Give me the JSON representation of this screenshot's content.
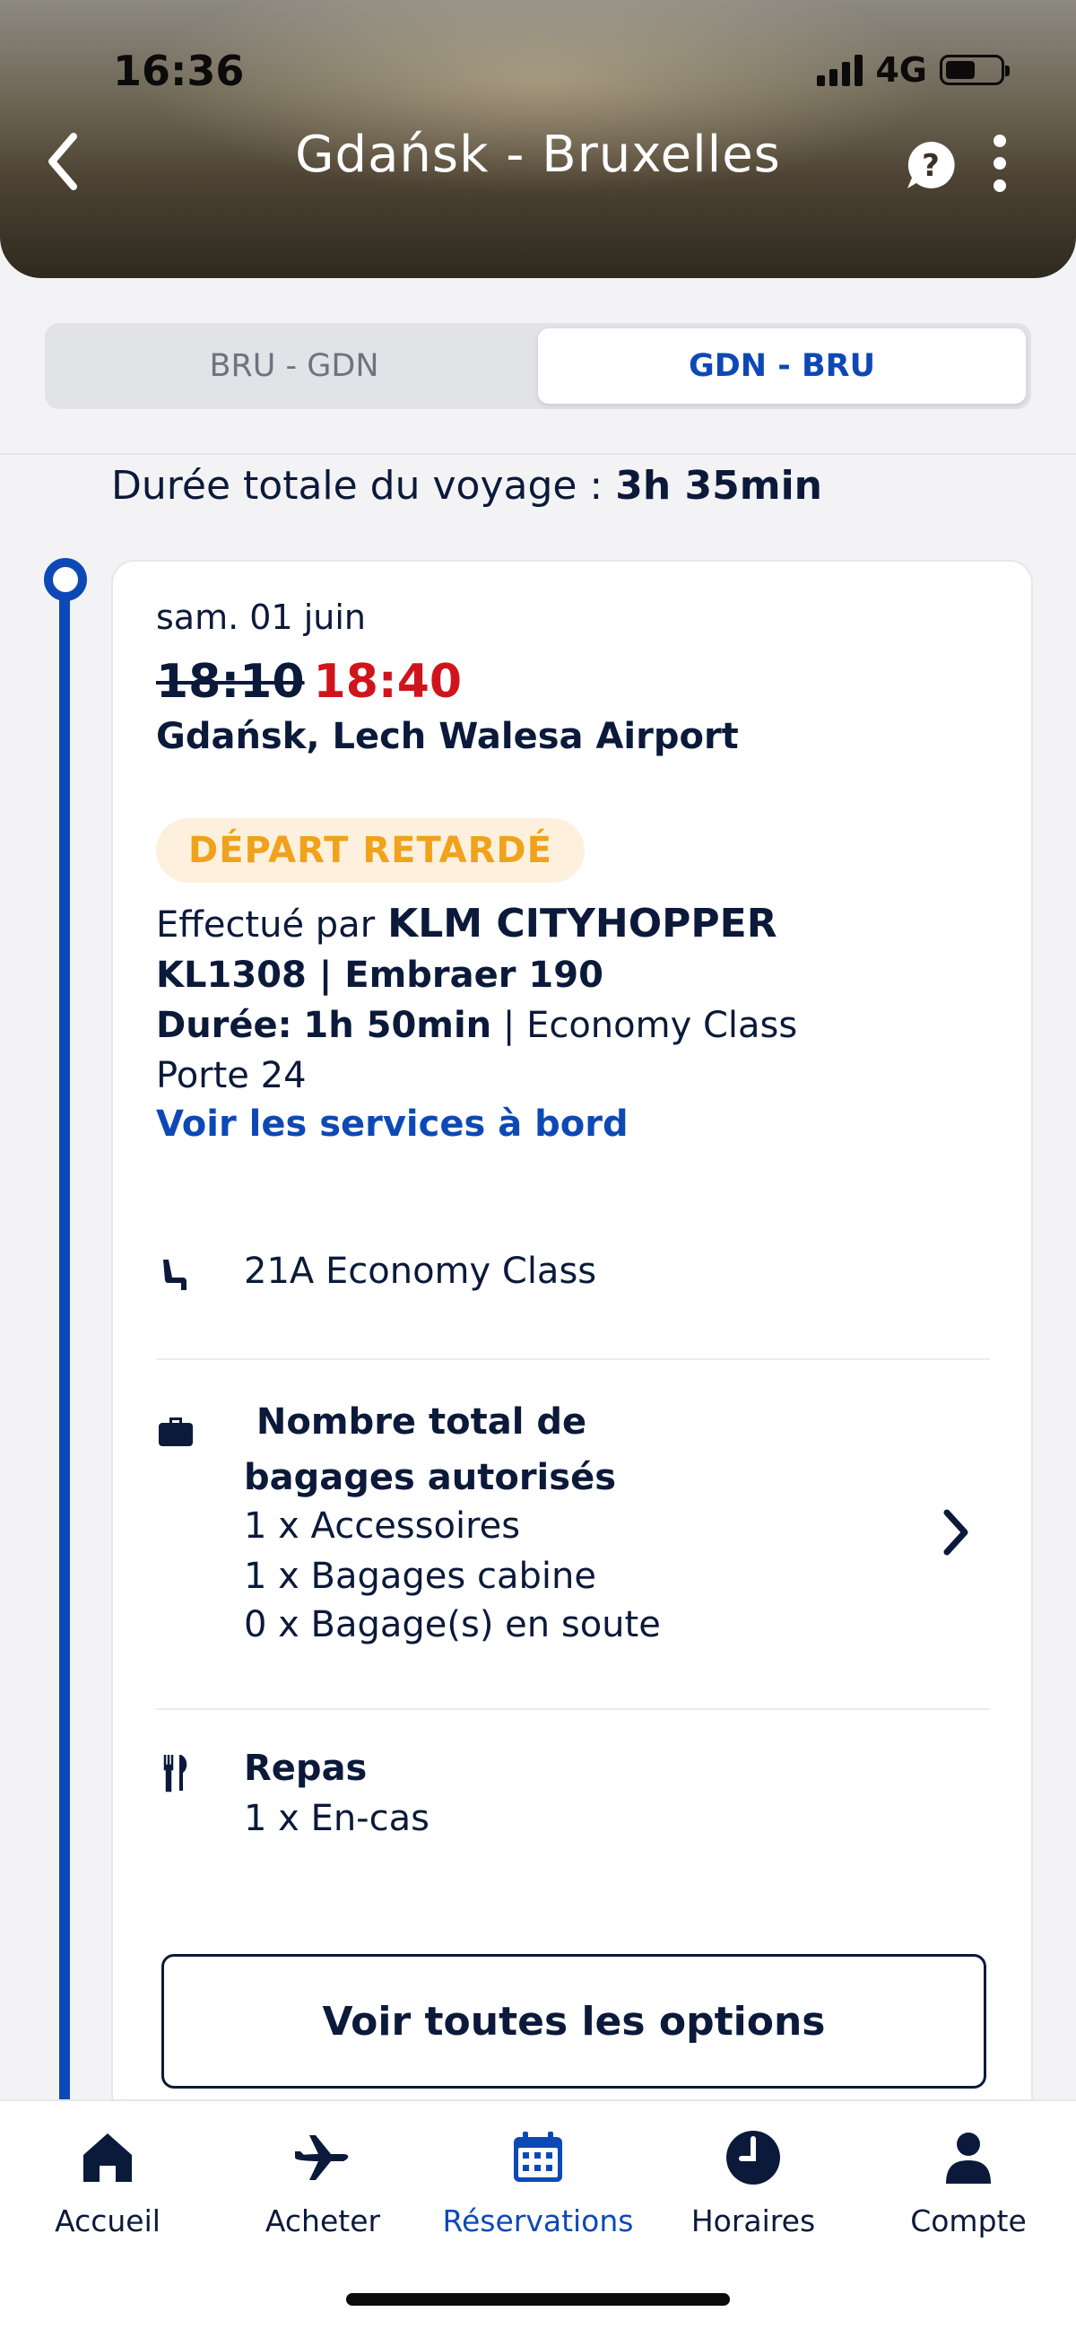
{
  "status_bar": {
    "time": "16:36",
    "network": "4G",
    "battery_level": 0.55
  },
  "header": {
    "title": "Gdańsk - Bruxelles"
  },
  "tabs": [
    {
      "label": "BRU - GDN",
      "active": false
    },
    {
      "label": "GDN - BRU",
      "active": true
    }
  ],
  "trip": {
    "duration_label": "Durée totale du voyage : ",
    "duration_value": "3h 35min"
  },
  "segment": {
    "date": "sam. 01 juin",
    "scheduled_time": "18:10",
    "new_time": "18:40",
    "airport": "Gdańsk, Lech Walesa Airport",
    "status_badge": "DÉPART RETARDÉ",
    "operated_label": "Effectué par",
    "operator": "KLM CITYHOPPER",
    "flight": "KL1308 | Embraer 190",
    "duration_label": "Durée:",
    "duration_value": "1h 50min",
    "cabin": "| Economy Class",
    "gate": "Porte 24",
    "services_link": "Voir les services à bord"
  },
  "seat": {
    "text": "21A Economy Class",
    "icon": "seat-icon"
  },
  "baggage": {
    "title_line1": " Nombre total de",
    "title_line2": "bagages autorisés",
    "items": [
      "1 x Accessoires",
      "1 x Bagages cabine",
      "0 x Bagage(s) en soute"
    ],
    "icon": "suitcase-icon"
  },
  "meal": {
    "title": "Repas",
    "item": "1 x En-cas",
    "icon": "cutlery-icon"
  },
  "options_button": "Voir toutes les options",
  "nav": [
    {
      "label": "Accueil",
      "icon": "home-icon",
      "active": false
    },
    {
      "label": "Acheter",
      "icon": "plane-icon",
      "active": false
    },
    {
      "label": "Réservations",
      "icon": "calendar-icon",
      "active": true
    },
    {
      "label": "Horaires",
      "icon": "clock-icon",
      "active": false
    },
    {
      "label": "Compte",
      "icon": "user-icon",
      "active": false
    }
  ],
  "colors": {
    "accent": "#0d49b6",
    "delay": "#d0141c",
    "badge_text": "#f0a21c",
    "badge_bg": "#fdf1de",
    "text": "#0b1a3a"
  }
}
